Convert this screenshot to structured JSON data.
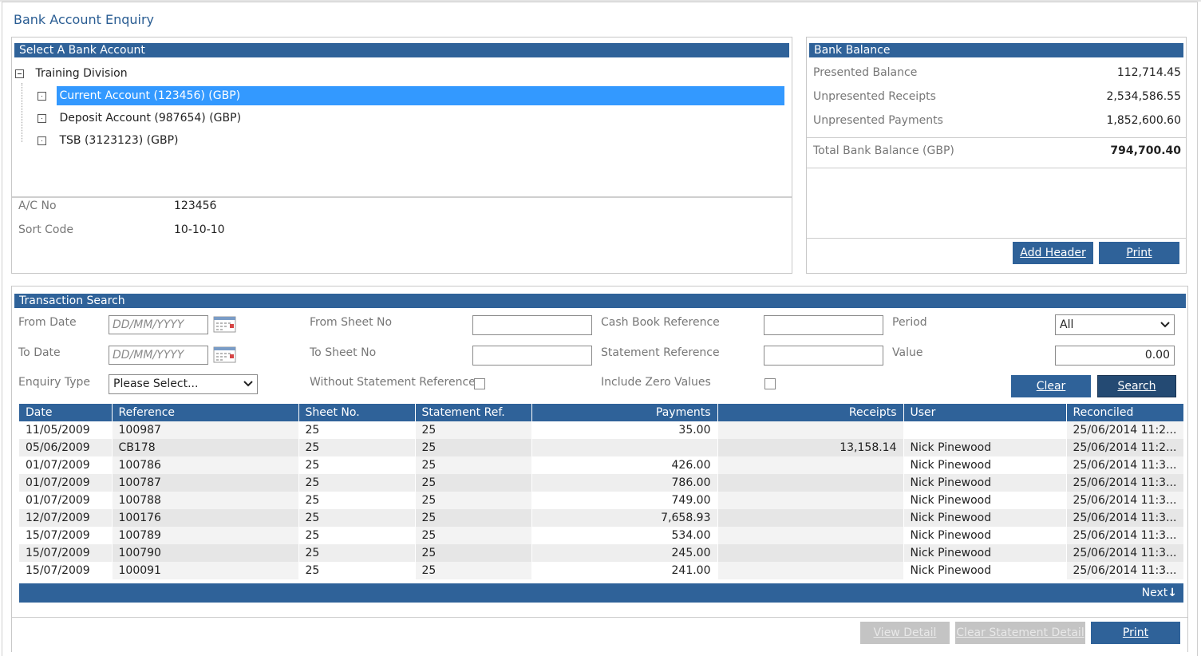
{
  "page": {
    "title": "Bank Account Enquiry"
  },
  "account_panel": {
    "header": "Select A Bank Account",
    "tree_root": "Training Division",
    "accounts": [
      "Current Account (123456) (GBP)",
      "Deposit Account (987654) (GBP)",
      "TSB (3123123) (GBP)"
    ],
    "selected_index": 0,
    "details": [
      {
        "label": "A/C No",
        "value": "123456"
      },
      {
        "label": "Sort Code",
        "value": "10-10-10"
      }
    ]
  },
  "balance_panel": {
    "header": "Bank Balance",
    "rows": [
      {
        "label": "Presented Balance",
        "value": "112,714.45"
      },
      {
        "label": "Unpresented Receipts",
        "value": "2,534,586.55"
      },
      {
        "label": "Unpresented Payments",
        "value": "1,852,600.60"
      }
    ],
    "total_label": "Total Bank Balance (GBP)",
    "total_value": "794,700.40",
    "add_header_label": "Add Header",
    "print_label": "Print"
  },
  "search": {
    "header": "Transaction Search",
    "from_date_label": "From Date",
    "to_date_label": "To Date",
    "date_placeholder": "DD/MM/YYYY",
    "enquiry_type_label": "Enquiry Type",
    "enquiry_type_value": "Please Select...",
    "from_sheet_label": "From Sheet No",
    "to_sheet_label": "To Sheet No",
    "without_statement_label": "Without Statement Reference",
    "cash_book_label": "Cash Book Reference",
    "statement_ref_label": "Statement Reference",
    "include_zero_label": "Include Zero Values",
    "period_label": "Period",
    "period_value": "All",
    "value_label": "Value",
    "value_value": "0.00",
    "clear_label": "Clear",
    "search_label": "Search"
  },
  "grid": {
    "columns": [
      "Date",
      "Reference",
      "Sheet No.",
      "Statement Ref.",
      "Payments",
      "Receipts",
      "User",
      "Reconciled"
    ],
    "rows": [
      [
        "11/05/2009",
        "100987",
        "25",
        "25",
        "35.00",
        "",
        "",
        "25/06/2014 11:2..."
      ],
      [
        "05/06/2009",
        "CB178",
        "25",
        "25",
        "",
        "13,158.14",
        "Nick Pinewood",
        "25/06/2014 11:2..."
      ],
      [
        "01/07/2009",
        "100786",
        "25",
        "25",
        "426.00",
        "",
        "Nick Pinewood",
        "25/06/2014 11:3..."
      ],
      [
        "01/07/2009",
        "100787",
        "25",
        "25",
        "786.00",
        "",
        "Nick Pinewood",
        "25/06/2014 11:3..."
      ],
      [
        "01/07/2009",
        "100788",
        "25",
        "25",
        "749.00",
        "",
        "Nick Pinewood",
        "25/06/2014 11:3..."
      ],
      [
        "12/07/2009",
        "100176",
        "25",
        "25",
        "7,658.93",
        "",
        "Nick Pinewood",
        "25/06/2014 11:3..."
      ],
      [
        "15/07/2009",
        "100789",
        "25",
        "25",
        "534.00",
        "",
        "Nick Pinewood",
        "25/06/2014 11:3..."
      ],
      [
        "15/07/2009",
        "100790",
        "25",
        "25",
        "245.00",
        "",
        "Nick Pinewood",
        "25/06/2014 11:3..."
      ],
      [
        "15/07/2009",
        "100091",
        "25",
        "25",
        "241.00",
        "",
        "Nick Pinewood",
        "25/06/2014 11:3..."
      ]
    ],
    "next_label": "Next"
  },
  "footer": {
    "view_detail_label": "View Detail",
    "clear_statement_label": "Clear Statement Detail",
    "print_label": "Print"
  },
  "colors": {
    "band": "#2f6299",
    "selected": "#3399ff",
    "disabled": "#c4c4c4"
  }
}
